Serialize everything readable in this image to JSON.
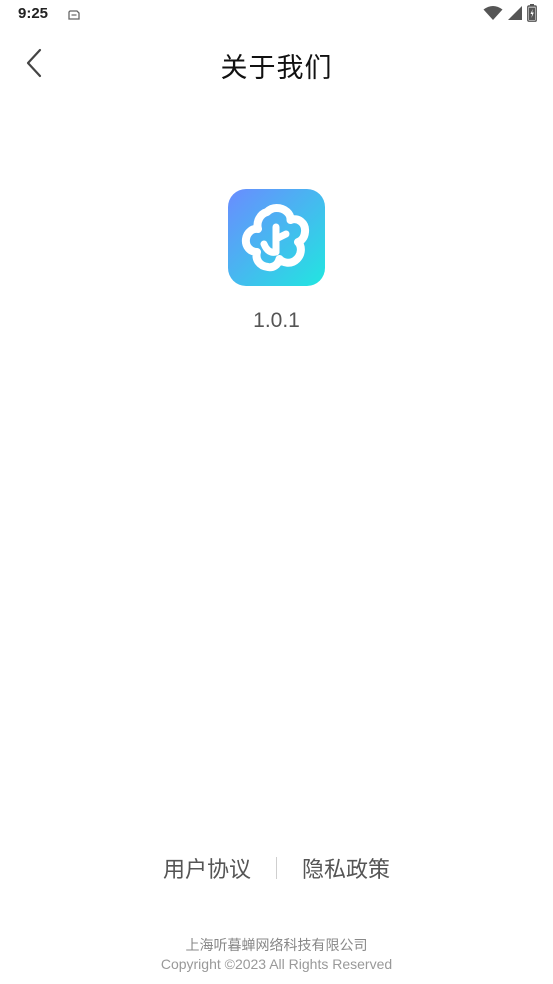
{
  "status_bar": {
    "time": "9:25"
  },
  "header": {
    "title": "关于我们"
  },
  "app": {
    "version": "1.0.1"
  },
  "links": {
    "user_agreement": "用户协议",
    "privacy_policy": "隐私政策"
  },
  "footer": {
    "company": "上海听暮蝉网络科技有限公司",
    "copyright": "Copyright ©2023 All Rights Reserved"
  },
  "colors": {
    "icon_gradient_start": "#6a8cff",
    "icon_gradient_end": "#21e6e0"
  }
}
